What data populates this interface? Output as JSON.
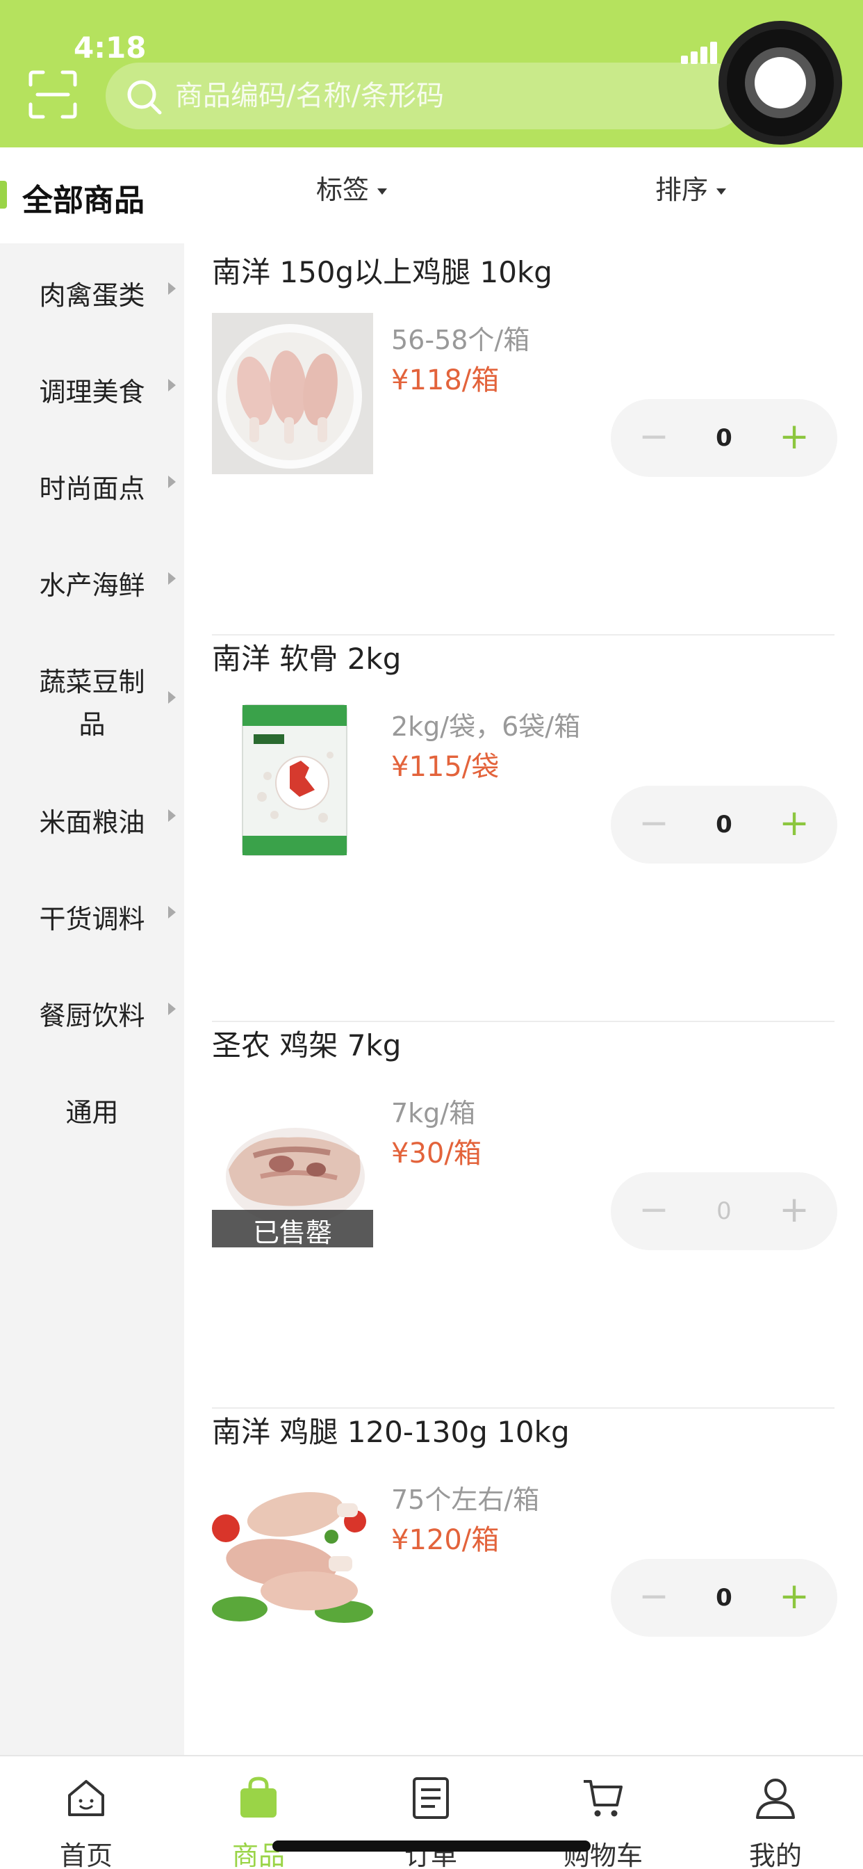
{
  "status": {
    "time": "4:18"
  },
  "search": {
    "placeholder": "商品编码/名称/条形码"
  },
  "sidebar": {
    "all_label": "全部商品",
    "items": [
      {
        "label": "肉禽蛋类",
        "arrow": true
      },
      {
        "label": "调理美食",
        "arrow": true
      },
      {
        "label": "时尚面点",
        "arrow": true
      },
      {
        "label": "水产海鲜",
        "arrow": true
      },
      {
        "label_line1": "蔬菜豆制",
        "label_line2": "品",
        "arrow": true
      },
      {
        "label": "米面粮油",
        "arrow": true
      },
      {
        "label": "干货调料",
        "arrow": true
      },
      {
        "label": "餐厨饮料",
        "arrow": true
      },
      {
        "label": "通用",
        "arrow": false
      }
    ]
  },
  "filters": {
    "tag_label": "标签",
    "sort_label": "排序"
  },
  "products": [
    {
      "name": "南洋 150g以上鸡腿 10kg",
      "spec": "56-58个/箱",
      "price": "¥118/箱",
      "qty": "0",
      "minus": "−",
      "plus": "+",
      "image": "chicken-drumsticks-plate"
    },
    {
      "name": "南洋 软骨 2kg",
      "spec": "2kg/袋，6袋/箱",
      "price": "¥115/袋",
      "qty": "0",
      "minus": "−",
      "plus": "+",
      "image": "cartilage-bag"
    },
    {
      "name": "圣农 鸡架 7kg",
      "spec": "7kg/箱",
      "price": "¥30/箱",
      "qty": "0",
      "minus": "−",
      "plus": "+",
      "image": "chicken-frame",
      "soldout_label": "已售罄"
    },
    {
      "name": "南洋 鸡腿 120-130g 10kg",
      "spec": "75个左右/箱",
      "price": "¥120/箱",
      "qty": "0",
      "minus": "−",
      "plus": "+",
      "image": "chicken-drumsticks-tomato"
    }
  ],
  "tabs": [
    {
      "label": "首页",
      "icon": "home-icon"
    },
    {
      "label": "商品",
      "icon": "bag-icon",
      "active": true
    },
    {
      "label": "订单",
      "icon": "order-icon"
    },
    {
      "label": "购物车",
      "icon": "cart-icon"
    },
    {
      "label": "我的",
      "icon": "user-icon"
    }
  ],
  "colors": {
    "brand": "#b5e25e",
    "accent": "#9ad447",
    "price": "#e3633b"
  }
}
